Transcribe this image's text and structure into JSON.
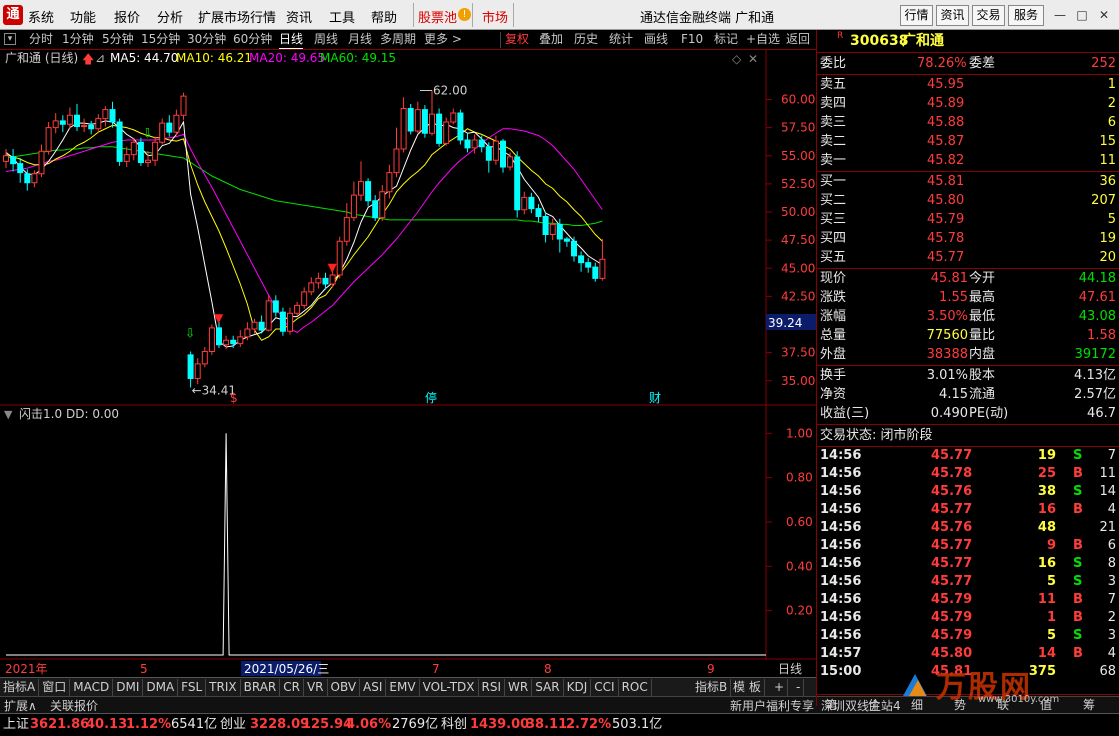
{
  "menu": {
    "items": [
      "系统",
      "功能",
      "报价",
      "分析",
      "扩展市场行情",
      "资讯",
      "工具",
      "帮助"
    ],
    "stockpool": "股票池",
    "market": "市场",
    "title": "通达信金融终端 广和通",
    "right_buttons": [
      "行情",
      "资讯",
      "交易",
      "服务"
    ]
  },
  "toolbar": {
    "items": [
      "分时",
      "1分钟",
      "5分钟",
      "15分钟",
      "30分钟",
      "60分钟",
      "日线",
      "周线",
      "月线",
      "多周期",
      "更多 >"
    ],
    "right": [
      "复权",
      "叠加",
      "历史",
      "统计",
      "画线",
      "F10",
      "标记",
      "+自选",
      "返回"
    ]
  },
  "chart_title": "广和通 (日线)",
  "ma": {
    "ma5": "MA5: 44.70",
    "ma10": "MA10: 46.21",
    "ma20": "MA20: 49.65",
    "ma60": "MA60: 49.15"
  },
  "colors": {
    "up": "#ff3c3c",
    "down": "#00ffff",
    "ma5": "#ffffff",
    "ma10": "#ffff00",
    "ma20": "#ff00ff",
    "ma60": "#00e000"
  },
  "chart_data": [
    {
      "type": "candlestick",
      "y_ticks": [
        60.0,
        57.5,
        55.0,
        52.5,
        50.0,
        47.5,
        45.0,
        42.5,
        37.5,
        35.0
      ],
      "ylim": [
        34.0,
        62.8
      ],
      "high_label": "62.00",
      "low_label": "34.41",
      "current_price_label": "39.24",
      "x_labels": [
        "2021年",
        "5",
        "2021/05/26/三",
        "7",
        "8",
        "9"
      ],
      "period_label": "日线",
      "markers": [
        "$",
        "停",
        "财"
      ],
      "candles": [
        [
          54.5,
          55.0,
          55.6,
          53.9
        ],
        [
          54.9,
          54.3,
          55.6,
          53.6
        ],
        [
          54.3,
          53.5,
          54.8,
          52.6
        ],
        [
          53.4,
          52.6,
          53.8,
          51.9
        ],
        [
          52.6,
          53.4,
          53.7,
          52.2
        ],
        [
          53.4,
          55.4,
          56.0,
          53.1
        ],
        [
          55.4,
          57.5,
          58.0,
          55.1
        ],
        [
          57.5,
          58.1,
          58.8,
          57.0
        ],
        [
          58.1,
          57.8,
          58.6,
          57.1
        ],
        [
          57.8,
          58.6,
          59.3,
          57.4
        ],
        [
          58.6,
          57.6,
          59.6,
          57.2
        ],
        [
          57.6,
          57.7,
          58.3,
          57.1
        ],
        [
          57.7,
          57.4,
          58.1,
          56.9
        ],
        [
          57.4,
          58.3,
          58.7,
          57.0
        ],
        [
          58.3,
          59.1,
          59.4,
          57.6
        ],
        [
          59.1,
          58.0,
          59.8,
          57.5
        ],
        [
          58.0,
          54.5,
          58.3,
          54.1
        ],
        [
          54.5,
          55.1,
          55.8,
          54.0
        ],
        [
          55.1,
          56.2,
          56.6,
          54.6
        ],
        [
          56.2,
          54.4,
          56.6,
          54.1
        ],
        [
          54.4,
          54.6,
          55.4,
          54.0
        ],
        [
          54.6,
          56.2,
          56.7,
          54.1
        ],
        [
          56.2,
          57.9,
          58.3,
          56.0
        ],
        [
          57.9,
          57.1,
          58.6,
          56.7
        ],
        [
          57.1,
          58.6,
          59.1,
          56.8
        ],
        [
          58.6,
          60.3,
          60.6,
          58.2
        ],
        [
          37.3,
          35.2,
          37.6,
          34.4
        ],
        [
          35.2,
          36.5,
          37.0,
          34.7
        ],
        [
          36.5,
          37.6,
          38.0,
          36.2
        ],
        [
          37.6,
          39.7,
          40.0,
          37.3
        ],
        [
          39.7,
          38.2,
          40.4,
          37.9
        ],
        [
          38.2,
          38.6,
          39.0,
          37.8
        ],
        [
          38.6,
          38.3,
          39.0,
          37.9
        ],
        [
          38.3,
          38.9,
          39.5,
          38.0
        ],
        [
          38.9,
          39.6,
          40.2,
          38.6
        ],
        [
          39.6,
          40.2,
          40.5,
          39.2
        ],
        [
          40.2,
          39.5,
          40.8,
          39.2
        ],
        [
          39.5,
          42.1,
          42.6,
          39.4
        ],
        [
          42.1,
          41.1,
          42.6,
          40.7
        ],
        [
          41.1,
          39.4,
          41.5,
          39.0
        ],
        [
          39.4,
          41.0,
          41.5,
          39.1
        ],
        [
          41.0,
          41.7,
          42.0,
          40.8
        ],
        [
          41.7,
          42.9,
          43.3,
          41.4
        ],
        [
          42.9,
          43.7,
          44.2,
          42.6
        ],
        [
          43.7,
          44.1,
          44.6,
          43.2
        ],
        [
          44.1,
          43.6,
          44.6,
          43.1
        ],
        [
          43.6,
          44.4,
          44.9,
          43.3
        ],
        [
          44.4,
          47.4,
          47.8,
          44.1
        ],
        [
          47.4,
          49.5,
          50.8,
          47.0
        ],
        [
          49.5,
          51.5,
          52.7,
          49.2
        ],
        [
          51.5,
          52.7,
          54.5,
          51.0
        ],
        [
          52.7,
          51.0,
          53.0,
          50.5
        ],
        [
          51.0,
          49.5,
          51.5,
          49.2
        ],
        [
          49.5,
          51.8,
          52.4,
          49.2
        ],
        [
          51.8,
          53.5,
          54.2,
          51.2
        ],
        [
          53.5,
          55.6,
          57.5,
          53.1
        ],
        [
          55.6,
          59.2,
          60.2,
          55.3
        ],
        [
          59.2,
          57.2,
          59.6,
          56.9
        ],
        [
          57.2,
          59.1,
          59.8,
          57.0
        ],
        [
          59.1,
          57.0,
          59.5,
          56.6
        ],
        [
          57.0,
          58.7,
          60.8,
          56.8
        ],
        [
          58.7,
          56.1,
          59.2,
          55.8
        ],
        [
          56.1,
          58.0,
          58.4,
          55.9
        ],
        [
          58.0,
          58.8,
          59.2,
          57.8
        ],
        [
          58.8,
          56.4,
          59.1,
          56.0
        ],
        [
          56.4,
          55.7,
          57.0,
          55.3
        ],
        [
          55.7,
          56.4,
          56.9,
          55.2
        ],
        [
          56.4,
          55.8,
          56.8,
          55.3
        ],
        [
          55.8,
          54.6,
          56.2,
          53.5
        ],
        [
          54.6,
          56.3,
          56.8,
          54.2
        ],
        [
          56.3,
          54.0,
          56.5,
          53.5
        ],
        [
          54.0,
          54.9,
          55.3,
          53.7
        ],
        [
          54.9,
          50.2,
          55.4,
          49.5
        ],
        [
          50.2,
          51.3,
          51.8,
          49.8
        ],
        [
          51.3,
          50.3,
          51.7,
          49.9
        ],
        [
          50.3,
          49.6,
          50.7,
          49.1
        ],
        [
          49.6,
          48.0,
          50.0,
          47.3
        ],
        [
          48.0,
          48.9,
          49.4,
          47.5
        ],
        [
          48.9,
          47.6,
          49.4,
          46.4
        ],
        [
          47.6,
          47.4,
          47.8,
          46.9
        ],
        [
          47.4,
          46.1,
          47.8,
          45.6
        ],
        [
          46.1,
          45.5,
          46.5,
          44.7
        ],
        [
          45.5,
          45.1,
          45.9,
          44.6
        ],
        [
          45.1,
          44.1,
          45.5,
          43.8
        ],
        [
          44.1,
          45.8,
          47.6,
          43.9
        ]
      ],
      "ma5": [
        55.3,
        54.8,
        54.0,
        53.4,
        53.3,
        53.8,
        54.5,
        55.4,
        56.4,
        57.5,
        57.9,
        57.9,
        57.8,
        57.9,
        58.1,
        58.0,
        57.5,
        56.9,
        56.5,
        55.7,
        55.0,
        55.1,
        55.9,
        56.1,
        56.9,
        58.0,
        51.6,
        48.6,
        45.3,
        42.0,
        38.5,
        38.0,
        38.1,
        38.6,
        38.9,
        39.1,
        39.3,
        39.9,
        40.6,
        40.4,
        40.7,
        40.7,
        41.2,
        41.7,
        42.5,
        43.2,
        43.7,
        44.6,
        45.8,
        47.3,
        49.1,
        50.4,
        50.8,
        51.4,
        51.9,
        52.3,
        53.9,
        55.5,
        56.9,
        57.5,
        58.0,
        57.6,
        57.8,
        57.5,
        57.4,
        57.0,
        57.1,
        56.5,
        55.8,
        55.8,
        55.4,
        55.0,
        54.0,
        52.9,
        52.1,
        51.3,
        49.9,
        49.6,
        48.8,
        48.1,
        47.4,
        46.8,
        46.1,
        45.7,
        45.3
      ],
      "ma10": [
        55.1,
        54.9,
        54.7,
        54.4,
        54.2,
        54.2,
        54.3,
        54.7,
        55.0,
        55.4,
        55.9,
        56.2,
        56.6,
        57.1,
        57.4,
        57.7,
        57.6,
        57.5,
        57.3,
        57.0,
        56.8,
        56.6,
        56.6,
        56.4,
        56.3,
        56.5,
        54.2,
        52.4,
        50.9,
        49.6,
        48.3,
        46.8,
        45.2,
        43.6,
        41.8,
        39.5,
        38.6,
        38.9,
        39.6,
        39.6,
        40.0,
        40.5,
        40.9,
        41.5,
        42.3,
        42.6,
        43.4,
        44.5,
        45.3,
        46.2,
        47.0,
        47.8,
        48.8,
        49.8,
        50.7,
        51.8,
        52.5,
        53.1,
        53.6,
        54.2,
        55.1,
        55.6,
        56.1,
        56.5,
        56.9,
        57.4,
        57.1,
        56.9,
        56.6,
        56.3,
        55.9,
        55.6,
        54.9,
        54.3,
        53.7,
        53.2,
        52.5,
        52.1,
        51.4,
        50.9,
        50.2,
        49.6,
        48.8,
        48.0,
        47.4
      ],
      "ma20": [
        53.6,
        53.7,
        53.8,
        53.9,
        54.1,
        54.3,
        54.5,
        54.6,
        54.8,
        55.0,
        55.2,
        55.4,
        55.6,
        55.8,
        56.0,
        56.2,
        56.3,
        56.4,
        56.4,
        56.4,
        56.4,
        56.4,
        56.5,
        56.6,
        56.7,
        56.9,
        55.6,
        54.4,
        53.3,
        52.2,
        51.0,
        49.8,
        48.6,
        47.4,
        46.2,
        45.0,
        43.8,
        42.6,
        41.5,
        40.5,
        39.6,
        39.3,
        39.8,
        40.2,
        40.7,
        41.2,
        41.7,
        42.4,
        43.1,
        43.8,
        44.4,
        45.0,
        45.6,
        46.2,
        46.9,
        47.6,
        48.4,
        49.2,
        50.0,
        50.9,
        51.8,
        52.6,
        53.3,
        54.0,
        54.6,
        55.1,
        55.6,
        56.1,
        56.6,
        57.0,
        57.4,
        57.4,
        57.3,
        57.2,
        57.0,
        56.8,
        56.4,
        55.9,
        55.2,
        54.5,
        53.8,
        52.9,
        52.0,
        51.1,
        50.2
      ],
      "ma60": [
        54.8,
        54.9,
        55.0,
        55.1,
        55.2,
        55.3,
        55.4,
        55.5,
        55.5,
        55.6,
        55.6,
        55.7,
        55.7,
        55.8,
        55.8,
        55.8,
        55.7,
        55.6,
        55.5,
        55.4,
        55.3,
        55.2,
        55.1,
        55.0,
        54.9,
        54.8,
        54.4,
        54.0,
        53.6,
        53.2,
        52.9,
        52.6,
        52.3,
        52.0,
        51.8,
        51.6,
        51.4,
        51.2,
        51.0,
        50.9,
        50.8,
        50.7,
        50.6,
        50.5,
        50.4,
        50.3,
        50.2,
        50.1,
        50.0,
        49.8,
        49.7,
        49.6,
        49.5,
        49.4,
        49.3,
        49.3,
        49.3,
        49.3,
        49.3,
        49.3,
        49.3,
        49.3,
        49.3,
        49.3,
        49.3,
        49.3,
        49.3,
        49.3,
        49.3,
        49.3,
        49.3,
        49.3,
        49.3,
        49.2,
        49.2,
        49.1,
        49.0,
        49.0,
        48.9,
        48.9,
        48.8,
        48.8,
        48.9,
        49.0,
        49.2
      ]
    },
    {
      "type": "line",
      "title": "闪击1.0",
      "indicator": "DD: 0.00",
      "y_ticks": [
        "1.00",
        "0.80",
        "0.60",
        "0.40",
        "0.20"
      ],
      "ylim": [
        0,
        1.06
      ],
      "spike_index": 31,
      "values_note": "zero except one spike of 1.00"
    }
  ],
  "quote": {
    "code": "300638",
    "name": "广和通",
    "r_mark": "R",
    "weibi_label": "委比",
    "weibi": "78.26%",
    "weicha_label": "委差",
    "weicha": "252",
    "asks": [
      {
        "label": "卖五",
        "price": "45.95",
        "vol": "1"
      },
      {
        "label": "卖四",
        "price": "45.89",
        "vol": "2"
      },
      {
        "label": "卖三",
        "price": "45.88",
        "vol": "6"
      },
      {
        "label": "卖二",
        "price": "45.87",
        "vol": "15"
      },
      {
        "label": "卖一",
        "price": "45.82",
        "vol": "11"
      }
    ],
    "bids": [
      {
        "label": "买一",
        "price": "45.81",
        "vol": "36"
      },
      {
        "label": "买二",
        "price": "45.80",
        "vol": "207"
      },
      {
        "label": "买三",
        "price": "45.79",
        "vol": "5"
      },
      {
        "label": "买四",
        "price": "45.78",
        "vol": "19"
      },
      {
        "label": "买五",
        "price": "45.77",
        "vol": "20"
      }
    ],
    "stats": [
      {
        "l1": "现价",
        "v1": "45.81",
        "c1": "red",
        "l2": "今开",
        "v2": "44.18",
        "c2": "grn"
      },
      {
        "l1": "涨跌",
        "v1": "1.55",
        "c1": "red",
        "l2": "最高",
        "v2": "47.61",
        "c2": "red"
      },
      {
        "l1": "涨幅",
        "v1": "3.50%",
        "c1": "red",
        "l2": "最低",
        "v2": "43.08",
        "c2": "grn"
      },
      {
        "l1": "总量",
        "v1": "77560",
        "c1": "yel",
        "l2": "量比",
        "v2": "1.58",
        "c2": "red"
      },
      {
        "l1": "外盘",
        "v1": "38388",
        "c1": "red",
        "l2": "内盘",
        "v2": "39172",
        "c2": "grn"
      }
    ],
    "stats2": [
      {
        "l1": "换手",
        "v1": "3.01%",
        "l2": "股本",
        "v2": "4.13亿"
      },
      {
        "l1": "净资",
        "v1": "4.15",
        "l2": "流通",
        "v2": "2.57亿"
      },
      {
        "l1": "收益(三)",
        "v1": "0.490",
        "l2": "PE(动)",
        "v2": "46.7"
      }
    ],
    "trade_status": "交易状态: 闭市阶段",
    "ticks": [
      {
        "t": "14:56",
        "p": "45.77",
        "v": "19",
        "f": "S",
        "n": "7"
      },
      {
        "t": "14:56",
        "p": "45.78",
        "v": "25",
        "f": "B",
        "n": "11"
      },
      {
        "t": "14:56",
        "p": "45.76",
        "v": "38",
        "f": "S",
        "n": "14"
      },
      {
        "t": "14:56",
        "p": "45.77",
        "v": "16",
        "f": "B",
        "n": "4"
      },
      {
        "t": "14:56",
        "p": "45.76",
        "v": "48",
        "f": "",
        "n": "21"
      },
      {
        "t": "14:56",
        "p": "45.77",
        "v": "9",
        "f": "B",
        "n": "6"
      },
      {
        "t": "14:56",
        "p": "45.77",
        "v": "16",
        "f": "S",
        "n": "8"
      },
      {
        "t": "14:56",
        "p": "45.77",
        "v": "5",
        "f": "S",
        "n": "3"
      },
      {
        "t": "14:56",
        "p": "45.79",
        "v": "11",
        "f": "B",
        "n": "7"
      },
      {
        "t": "14:56",
        "p": "45.79",
        "v": "1",
        "f": "B",
        "n": "2"
      },
      {
        "t": "14:56",
        "p": "45.79",
        "v": "5",
        "f": "S",
        "n": "3"
      },
      {
        "t": "14:57",
        "p": "45.80",
        "v": "14",
        "f": "B",
        "n": "4"
      },
      {
        "t": "15:00",
        "p": "45.81",
        "v": "375",
        "f": "",
        "n": "68"
      }
    ],
    "tabs": [
      "笔",
      "价",
      "细",
      "势",
      "联",
      "值",
      "筹"
    ]
  },
  "bottom": {
    "tabs": [
      "指标A",
      "窗口",
      "MACD",
      "DMI",
      "DMA",
      "FSL",
      "TRIX",
      "BRAR",
      "CR",
      "VR",
      "OBV",
      "ASI",
      "EMV",
      "VOL-TDX",
      "RSI",
      "WR",
      "SAR",
      "KDJ",
      "CCI",
      "ROC"
    ],
    "right": [
      "指标B",
      "模 板",
      "+",
      "-"
    ],
    "row2": [
      "扩展∧",
      "关联报价"
    ],
    "promo": "新用户福利专享",
    "link": "深圳双线主站4"
  },
  "status": {
    "sh_label": "上证",
    "sh": "3621.86",
    "sh_chg": "40.13",
    "sh_pct": "1.12%",
    "sh_amt": "6541亿",
    "cy_label": "创业",
    "cy": "3228.09",
    "cy_chg": "125.94",
    "cy_pct": "4.06%",
    "cy_amt": "2769亿",
    "kc_label": "科创",
    "kc": "1439.00",
    "kc_chg": "38.11",
    "kc_pct": "2.72%",
    "kc_amt": "503.1亿"
  },
  "watermark": {
    "text": "万股网",
    "url": "www.3010y.com"
  }
}
